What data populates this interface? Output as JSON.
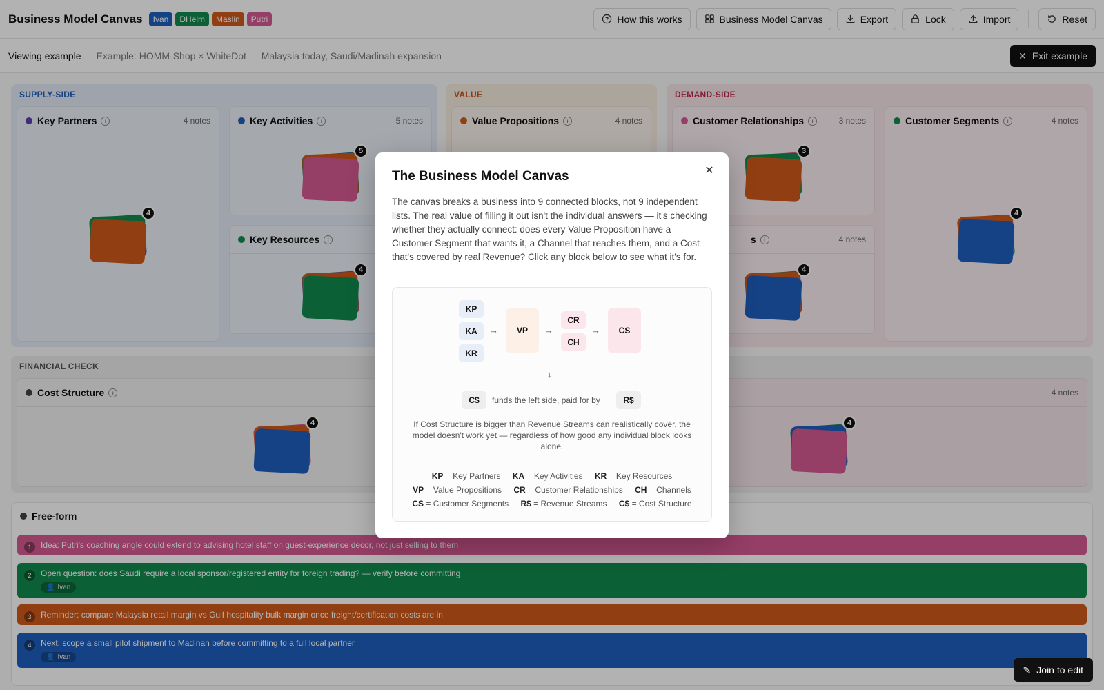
{
  "header": {
    "title": "Business Model Canvas",
    "tags": [
      {
        "label": "Ivan",
        "color": "#1f5fbf"
      },
      {
        "label": "DHelm",
        "color": "#118a4e"
      },
      {
        "label": "Maslin",
        "color": "#d25a1c"
      },
      {
        "label": "Putri",
        "color": "#d65a92"
      }
    ],
    "actions": {
      "how": "How this works",
      "bmc": "Business Model Canvas",
      "export": "Export",
      "lock": "Lock",
      "import": "Import",
      "reset": "Reset"
    }
  },
  "subbar": {
    "viewing": "Viewing example —",
    "example": "Example: HOMM-Shop × WhiteDot — Malaysia today, Saudi/Madinah expansion",
    "exit": "Exit example"
  },
  "sections": {
    "supply": "SUPPLY-SIDE",
    "value": "VALUE",
    "demand": "DEMAND-SIDE",
    "financial": "FINANCIAL CHECK"
  },
  "blocks": {
    "kp": {
      "title": "Key Partners",
      "count": "4 notes",
      "badge": "4"
    },
    "ka": {
      "title": "Key Activities",
      "count": "5 notes",
      "badge": "5"
    },
    "kr": {
      "title": "Key Resources",
      "badge": "4"
    },
    "vp": {
      "title": "Value Propositions",
      "count": "4 notes"
    },
    "cr": {
      "title": "Customer Relationships",
      "count": "3 notes",
      "badge": "3"
    },
    "ch": {
      "title_fragment": "s",
      "count": "4 notes",
      "badge": "4"
    },
    "cs": {
      "title": "Customer Segments",
      "count": "4 notes",
      "badge": "4"
    },
    "cost": {
      "title": "Cost Structure",
      "badge": "4"
    },
    "rev": {
      "count": "4 notes",
      "badge": "4"
    }
  },
  "freeform": {
    "title": "Free-form",
    "notes": [
      {
        "num": "1",
        "text": "Idea: Putri's coaching angle could extend to advising hotel staff on guest-experience decor, not just selling to them",
        "color": "#d65a92",
        "author": ""
      },
      {
        "num": "2",
        "text": "Open question: does Saudi require a local sponsor/registered entity for foreign trading? — verify before committing",
        "color": "#118a4e",
        "author": "Ivan"
      },
      {
        "num": "3",
        "text": "Reminder: compare Malaysia retail margin vs Gulf hospitality bulk margin once freight/certification costs are in",
        "color": "#d25a1c",
        "author": ""
      },
      {
        "num": "4",
        "text": "Next: scope a small pilot shipment to Madinah before committing to a full local partner",
        "color": "#1f5fbf",
        "author": "Ivan"
      }
    ]
  },
  "join": "Join to edit",
  "modal": {
    "title": "The Business Model Canvas",
    "body": "The canvas breaks a business into 9 connected blocks, not 9 independent lists. The real value of filling it out isn't the individual answers — it's checking whether they actually connect: does every Value Proposition have a Customer Segment that wants it, a Channel that reaches them, and a Cost that's covered by real Revenue? Click any block below to see what it's for.",
    "chips": {
      "kp": "KP",
      "ka": "KA",
      "kr": "KR",
      "vp": "VP",
      "cr": "CR",
      "ch": "CH",
      "cs": "CS",
      "cost": "C$",
      "rev": "R$"
    },
    "funds": "funds the left side, paid for by",
    "note": "If Cost Structure is bigger than Revenue Streams can realistically cover, the model doesn't work yet — regardless of how good any individual block looks alone.",
    "legend": [
      [
        {
          "k": "KP",
          "v": "= Key Partners"
        },
        {
          "k": "KA",
          "v": "= Key Activities"
        },
        {
          "k": "KR",
          "v": "= Key Resources"
        }
      ],
      [
        {
          "k": "VP",
          "v": "= Value Propositions"
        },
        {
          "k": "CR",
          "v": "= Customer Relationships"
        },
        {
          "k": "CH",
          "v": "= Channels"
        }
      ],
      [
        {
          "k": "CS",
          "v": "= Customer Segments"
        },
        {
          "k": "R$",
          "v": "= Revenue Streams"
        },
        {
          "k": "C$",
          "v": "= Cost Structure"
        }
      ]
    ]
  }
}
